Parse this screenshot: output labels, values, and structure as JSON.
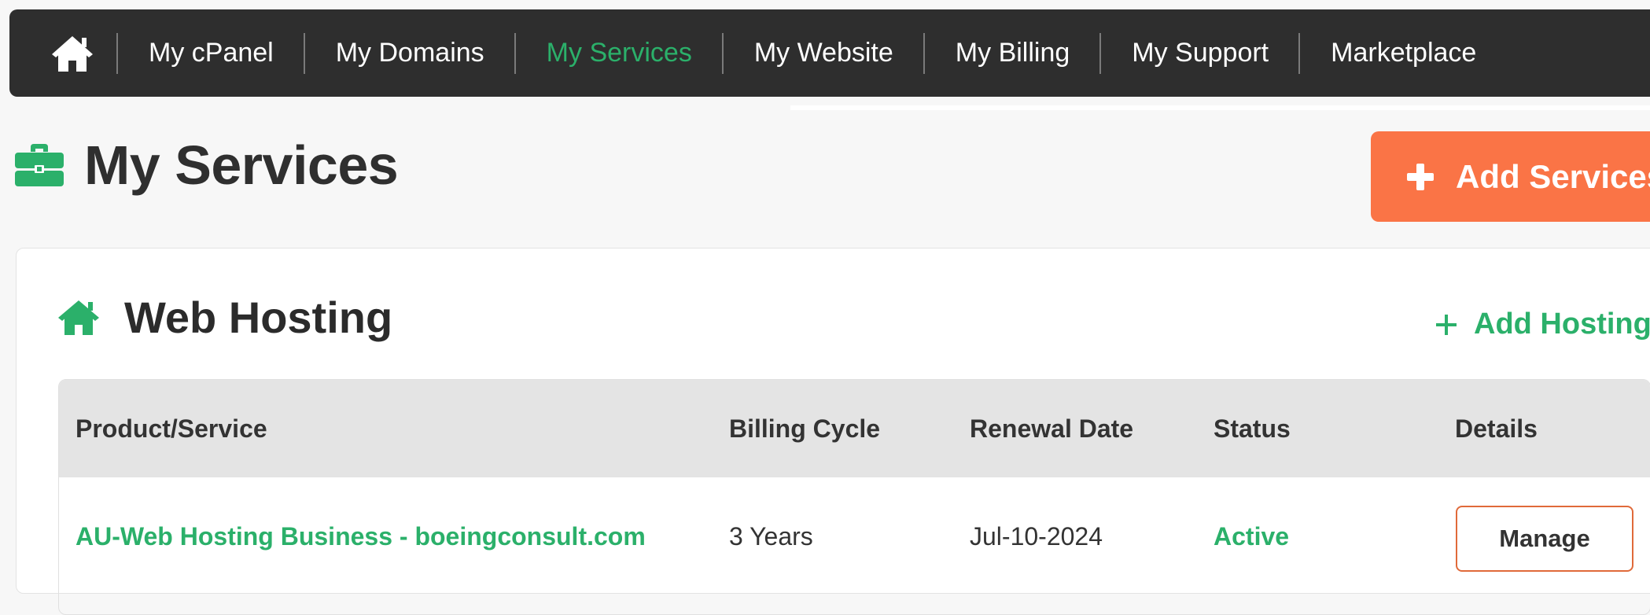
{
  "nav": {
    "items": [
      {
        "label": "My cPanel"
      },
      {
        "label": "My Domains"
      },
      {
        "label": "My Services"
      },
      {
        "label": "My Website"
      },
      {
        "label": "My Billing"
      },
      {
        "label": "My Support"
      },
      {
        "label": "Marketplace"
      }
    ],
    "active": "My Services"
  },
  "page": {
    "title": "My Services",
    "add_button_label": "Add Services"
  },
  "section": {
    "title": "Web Hosting",
    "add_link_label": "Add Hosting"
  },
  "table": {
    "headers": [
      "Product/Service",
      "Billing Cycle",
      "Renewal Date",
      "Status",
      "Details"
    ],
    "rows": [
      {
        "product": "AU-Web Hosting Business - boeingconsult.com",
        "billing_cycle": "3 Years",
        "renewal_date": "Jul-10-2024",
        "status": "Active",
        "action_label": "Manage"
      }
    ]
  },
  "colors": {
    "nav_background": "#2e2e2e",
    "accent_green": "#2bb06a",
    "add_button_orange": "#fa7446",
    "manage_border": "#e06a3a"
  },
  "icons": {
    "nav_home": "home-icon",
    "page_title": "briefcase-icon",
    "section_title": "house-icon",
    "add": "plus-icon"
  }
}
